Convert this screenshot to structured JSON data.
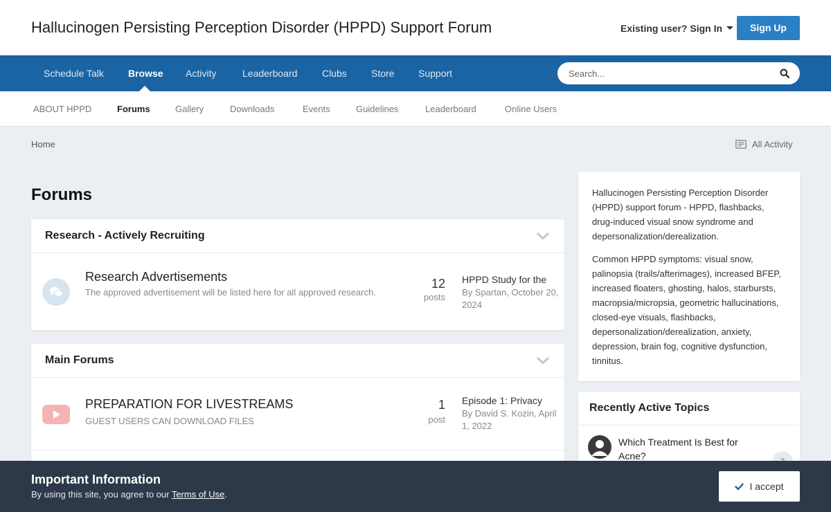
{
  "header": {
    "site_title": "Hallucinogen Persisting Perception Disorder (HPPD) Support Forum",
    "signin_label": "Existing user? Sign In",
    "signup_label": "Sign Up"
  },
  "nav": {
    "items": [
      "Schedule Talk",
      "Browse",
      "Activity",
      "Leaderboard",
      "Clubs",
      "Store",
      "Support"
    ],
    "active": "Browse",
    "search_placeholder": "Search..."
  },
  "subnav": {
    "items": [
      "ABOUT HPPD",
      "Forums",
      "Gallery",
      "Downloads",
      "Events",
      "Guidelines",
      "Leaderboard",
      "Online Users"
    ],
    "active": "Forums"
  },
  "breadcrumb": {
    "home": "Home",
    "all_activity": "All Activity"
  },
  "page_title": "Forums",
  "categories": [
    {
      "title": "Research - Actively Recruiting",
      "forums": [
        {
          "name": "Research Advertisements",
          "description": "The approved advertisement will be listed here for all approved research.",
          "count": "12",
          "count_label": "posts",
          "last_title": "HPPD Study for the",
          "last_by": "By Spartan, October 20, 2024",
          "icon": "chat-bubbles-icon"
        }
      ]
    },
    {
      "title": "Main Forums",
      "forums": [
        {
          "name": "PREPARATION FOR LIVESTREAMS",
          "description": "GUEST USERS CAN DOWNLOAD FILES",
          "count": "1",
          "count_label": "post",
          "last_title": "Episode 1: Privacy",
          "last_by": "By David S. Kozin, April 1, 2022",
          "icon": "youtube-icon"
        }
      ]
    }
  ],
  "sidebar": {
    "about_paragraphs": [
      "Hallucinogen Persisting Perception Disorder (HPPD) support forum - HPPD, flashbacks, drug-induced visual snow syndrome and depersonalization/derealization.",
      "Common HPPD symptoms: visual snow, palinopsia (trails/afterimages), increased BFEP, increased floaters, ghosting, halos, starbursts, macropsia/micropsia, geometric hallucinations, closed-eye visuals, flashbacks, depersonalization/derealization, anxiety, depression, brain fog, cognitive dysfunction, tinnitus."
    ],
    "recent_title": "Recently Active Topics",
    "recent_topics": [
      {
        "title": "Which Treatment Is Best for Acne?",
        "count": "2"
      }
    ]
  },
  "notice": {
    "title": "Important Information",
    "text_before": "By using this site, you agree to our ",
    "link": "Terms of Use",
    "text_after": ".",
    "accept_label": "I accept"
  },
  "colors": {
    "nav_bg": "#1a64a4",
    "accent": "#2b7fc4",
    "notice_bg": "#2d3848",
    "youtube_red": "#f4a9a9"
  }
}
